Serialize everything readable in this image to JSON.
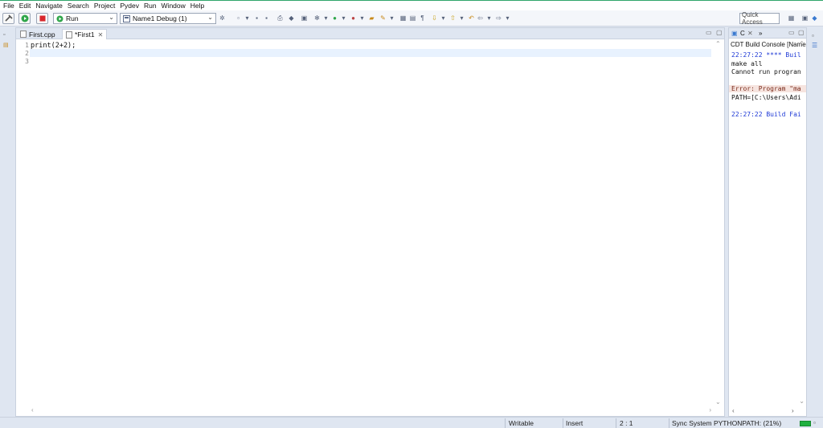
{
  "menu": [
    "File",
    "Edit",
    "Navigate",
    "Search",
    "Project",
    "Pydev",
    "Run",
    "Window",
    "Help"
  ],
  "toolbar": {
    "launch_mode": "Run",
    "launch_config": "Name1 Debug (1)",
    "quick_access": "Quick Access"
  },
  "editor": {
    "tabs": [
      {
        "label": "First.cpp",
        "active": false
      },
      {
        "label": "*First1",
        "active": true
      }
    ],
    "line_numbers": [
      "1",
      "2",
      "3"
    ],
    "lines": [
      "print(2+2);",
      "",
      ""
    ]
  },
  "console": {
    "tab_label": "C",
    "tab_label2": "»",
    "title": "CDT Build Console [Name1",
    "lines": [
      {
        "text": "22:27:22 **** Buil",
        "style": "blue"
      },
      {
        "text": "make all",
        "style": "normal"
      },
      {
        "text": "Cannot run progran",
        "style": "normal"
      },
      {
        "text": "Error: Program \"ma",
        "style": "error"
      },
      {
        "text": "PATH=[C:\\Users\\Adi",
        "style": "normal"
      },
      {
        "text": "22:27:22 Build Fai",
        "style": "blue"
      }
    ]
  },
  "status": {
    "writable": "Writable",
    "insert_mode": "Insert",
    "position": "2 : 1",
    "task": "Sync System PYTHONPATH: (21%)",
    "task_progress": 0.21
  },
  "colors": {
    "accent_line": "#2fa66a",
    "console_blue": "#1f3ad6",
    "error_bg": "#f6e4df"
  }
}
